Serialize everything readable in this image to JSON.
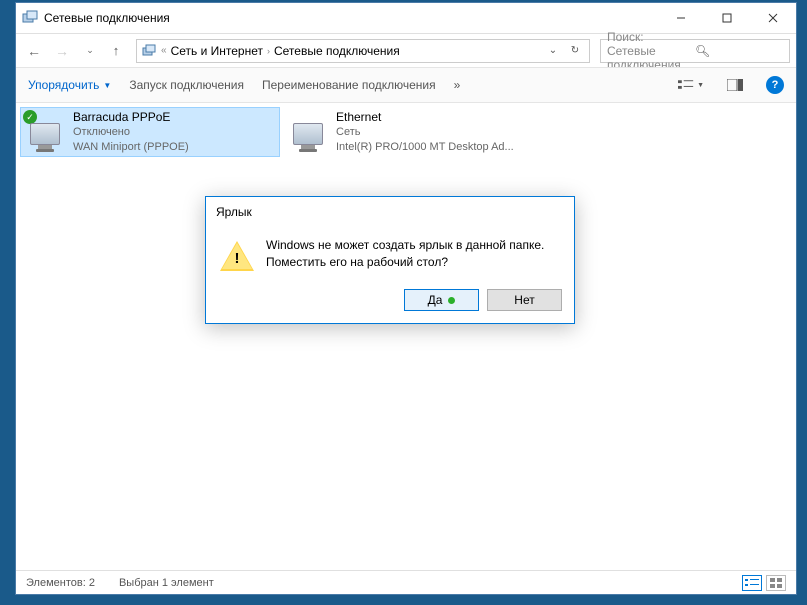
{
  "titlebar": {
    "title": "Сетевые подключения"
  },
  "breadcrumb": {
    "level1": "Сеть и Интернет",
    "level2": "Сетевые подключения"
  },
  "search": {
    "placeholder": "Поиск: Сетевые подключения"
  },
  "toolbar": {
    "organize": "Упорядочить",
    "start": "Запуск подключения",
    "rename": "Переименование подключения",
    "overflow": "»"
  },
  "connections": [
    {
      "name": "Barracuda PPPoE",
      "status": "Отключено",
      "device": "WAN Miniport (PPPOE)"
    },
    {
      "name": "Ethernet",
      "status": "Сеть",
      "device": "Intel(R) PRO/1000 MT Desktop Ad..."
    }
  ],
  "statusbar": {
    "count": "Элементов: 2",
    "selected": "Выбран 1 элемент"
  },
  "dialog": {
    "title": "Ярлык",
    "line1": "Windows не может создать ярлык в данной папке.",
    "line2": "Поместить его на рабочий стол?",
    "yes": "Да",
    "no": "Нет"
  }
}
